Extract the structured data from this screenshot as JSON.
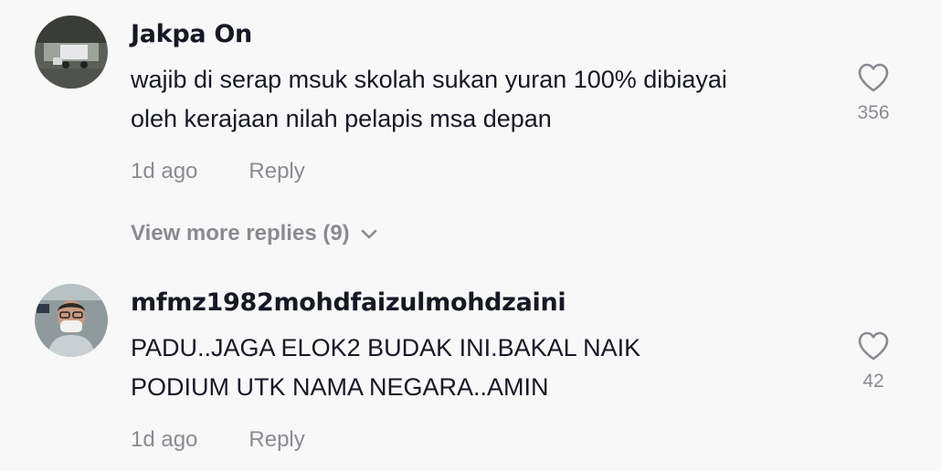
{
  "comments": [
    {
      "username": "Jakpa On",
      "text_lines": [
        "wajib di serap msuk skolah sukan yuran 100% dibiayai",
        "oleh kerajaan nilah pelapis msa depan"
      ],
      "time": "1d ago",
      "reply_label": "Reply",
      "like_count": "356",
      "view_more_replies": "View more replies (9)"
    },
    {
      "username": "mfmz1982mohdfaizulmohdzaini",
      "text_lines": [
        "PADU..JAGA ELOK2 BUDAK INI.BAKAL NAIK",
        "PODIUM UTK NAMA NEGARA..AMIN"
      ],
      "time": "1d ago",
      "reply_label": "Reply",
      "like_count": "42"
    }
  ],
  "colors": {
    "background": "#f8f8f8",
    "primary_text": "#161823",
    "secondary_text": "#8a8b91"
  },
  "icons": {
    "like": "heart-outline-icon",
    "expand": "chevron-down-icon"
  }
}
